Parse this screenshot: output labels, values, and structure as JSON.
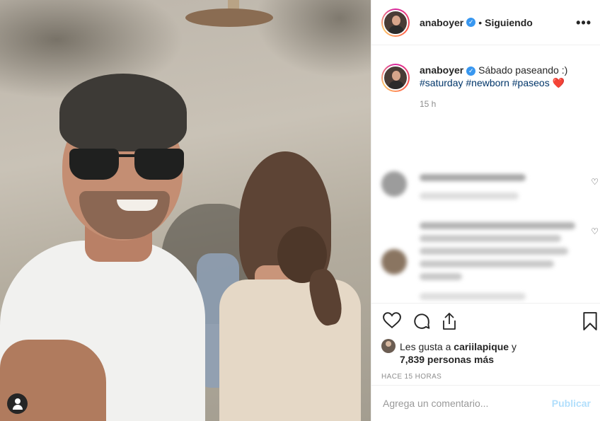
{
  "post": {
    "username": "anaboyer",
    "follow_state": "Siguiendo",
    "caption_text": "Sábado paseando :)",
    "hashtags": [
      "#saturday",
      "#newborn",
      "#paseos"
    ],
    "caption_emoji": "❤️",
    "caption_time": "15 h",
    "likes_prefix": "Les gusta a",
    "likes_user": "cariilapique",
    "likes_conj": "y",
    "likes_count": "7,839 personas más",
    "posted_ago": "HACE 15 HORAS"
  },
  "comment_box": {
    "placeholder": "Agrega un comentario...",
    "publish_label": "Publicar"
  },
  "icons": {
    "verified": "verified-badge-icon",
    "more": "more-options-icon",
    "like": "heart-icon",
    "comment": "comment-icon",
    "share": "share-icon",
    "save": "bookmark-icon",
    "user_tag": "user-tag-icon"
  },
  "colors": {
    "link": "#003569",
    "verified": "#3897f0",
    "publish_disabled": "#b2dffc",
    "muted": "#8e8e8e"
  }
}
